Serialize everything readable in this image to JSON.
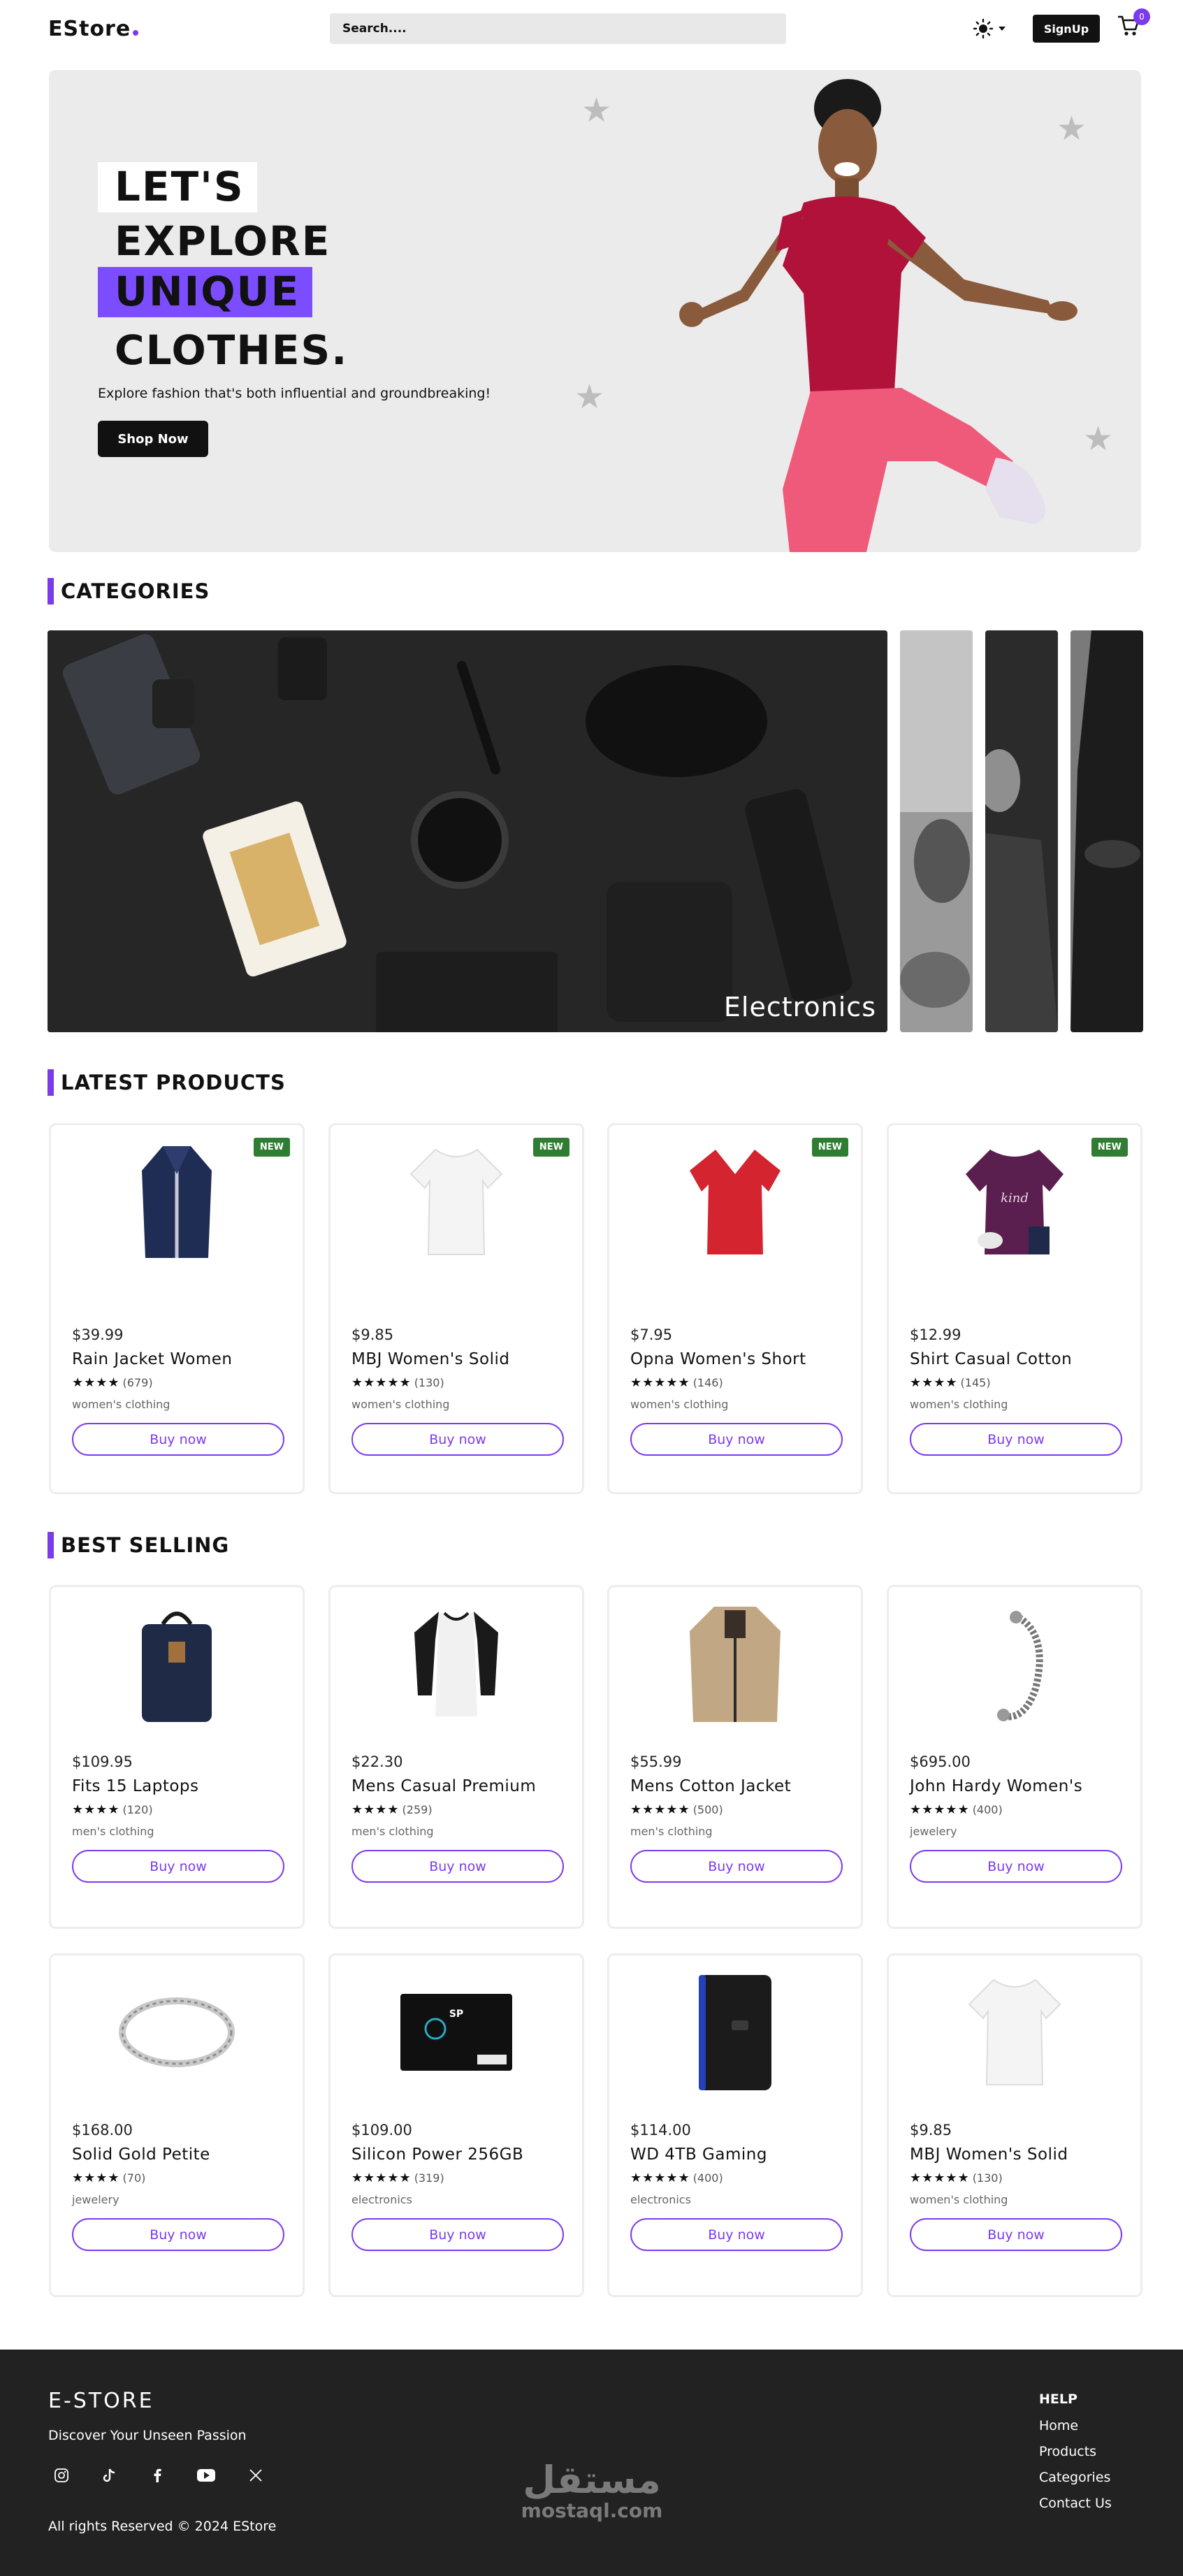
{
  "header": {
    "logo": "EStore",
    "search_placeholder": "Search....",
    "signup_label": "SignUp",
    "cart_count": "0"
  },
  "hero": {
    "lines": [
      "LET'S",
      "EXPLORE",
      "UNIQUE",
      "CLOTHES."
    ],
    "subtitle": "Explore fashion that's both influential and groundbreaking!",
    "cta": "Shop Now"
  },
  "categories": {
    "title": "CATEGORIES",
    "active_label": "Electronics"
  },
  "latest": {
    "title": "LATEST PRODUCTS",
    "badge": "NEW",
    "buy_label": "Buy now",
    "products": [
      {
        "price": "$39.99",
        "name": "Rain Jacket Women",
        "stars": "★★★★",
        "count": "(679)",
        "category": "women's clothing",
        "icon": "jacket-navy"
      },
      {
        "price": "$9.85",
        "name": "MBJ Women's Solid",
        "stars": "★★★★★",
        "count": "(130)",
        "category": "women's clothing",
        "icon": "tshirt-white"
      },
      {
        "price": "$7.95",
        "name": "Opna Women's Short",
        "stars": "★★★★★",
        "count": "(146)",
        "category": "women's clothing",
        "icon": "tshirt-red"
      },
      {
        "price": "$12.99",
        "name": "Shirt Casual Cotton",
        "stars": "★★★★",
        "count": "(145)",
        "category": "women's clothing",
        "icon": "tshirt-purple"
      }
    ]
  },
  "best": {
    "title": "BEST SELLING",
    "buy_label": "Buy now",
    "products": [
      {
        "price": "$109.95",
        "name": "Fits 15 Laptops",
        "stars": "★★★★",
        "count": "(120)",
        "category": "men's clothing",
        "icon": "backpack"
      },
      {
        "price": "$22.30",
        "name": "Mens Casual Premium",
        "stars": "★★★★",
        "count": "(259)",
        "category": "men's clothing",
        "icon": "raglan-tee"
      },
      {
        "price": "$55.99",
        "name": "Mens Cotton Jacket",
        "stars": "★★★★★",
        "count": "(500)",
        "category": "men's clothing",
        "icon": "jacket-beige"
      },
      {
        "price": "$695.00",
        "name": "John Hardy Women's",
        "stars": "★★★★★",
        "count": "(400)",
        "category": "jewelery",
        "icon": "bracelet"
      },
      {
        "price": "$168.00",
        "name": "Solid Gold Petite",
        "stars": "★★★★",
        "count": "(70)",
        "category": "jewelery",
        "icon": "ring"
      },
      {
        "price": "$109.00",
        "name": "Silicon Power 256GB",
        "stars": "★★★★★",
        "count": "(319)",
        "category": "electronics",
        "icon": "ssd"
      },
      {
        "price": "$114.00",
        "name": "WD 4TB Gaming",
        "stars": "★★★★★",
        "count": "(400)",
        "category": "electronics",
        "icon": "hdd"
      },
      {
        "price": "$9.85",
        "name": "MBJ Women's Solid",
        "stars": "★★★★★",
        "count": "(130)",
        "category": "women's clothing",
        "icon": "tshirt-white"
      }
    ]
  },
  "footer": {
    "brand": "E-STORE",
    "tagline": "Discover Your Unseen Passion",
    "copyright": "All rights Reserved © 2024 EStore",
    "help_title": "HELP",
    "links": [
      "Home",
      "Products",
      "Categories",
      "Contact Us"
    ],
    "watermark_ar": "مستقل",
    "watermark_en": "mostaql.com"
  },
  "colors": {
    "accent": "#7c3aed",
    "new_badge": "#2e7d32",
    "footer_bg": "#222222",
    "hero_bg": "#ebebeb"
  }
}
